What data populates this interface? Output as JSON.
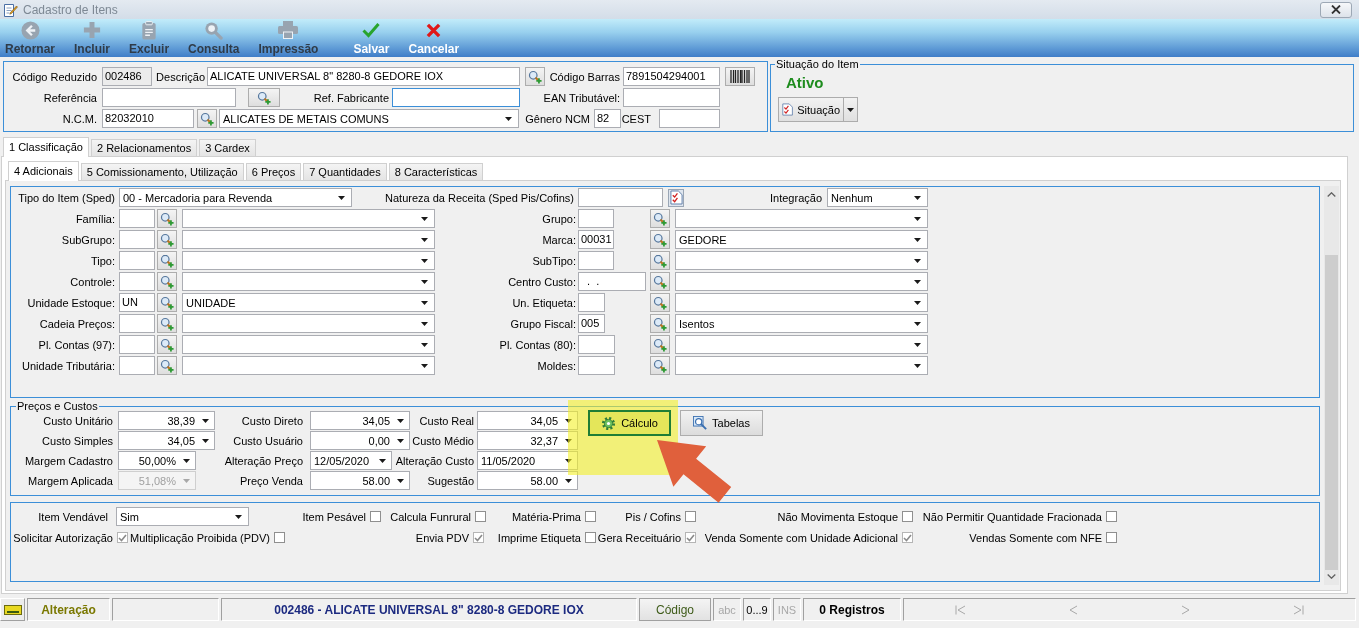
{
  "window": {
    "title": "Cadastro de Itens"
  },
  "toolbar": [
    {
      "kind": "back",
      "label": "Retornar",
      "disabled": true
    },
    {
      "kind": "add",
      "label": "Incluir",
      "disabled": true
    },
    {
      "kind": "delete",
      "label": "Excluir",
      "disabled": true
    },
    {
      "kind": "query",
      "label": "Consulta",
      "disabled": true
    },
    {
      "kind": "print",
      "label": "Impressão",
      "disabled": true
    },
    {
      "kind": "save",
      "label": "Salvar",
      "disabled": false
    },
    {
      "kind": "cancel",
      "label": "Cancelar",
      "disabled": false
    }
  ],
  "header": {
    "codigo_reduzido": {
      "label": "Código Reduzido",
      "value": "002486",
      "readonly": true
    },
    "descricao": {
      "label": "Descrição",
      "value": "ALICATE UNIVERSAL 8\" 8280-8 GEDORE IOX"
    },
    "codigo_barras": {
      "label": "Código Barras",
      "value": "7891504294001"
    },
    "referencia": {
      "label": "Referência"
    },
    "ref_fabricante": {
      "label": "Ref. Fabricante",
      "focused": true
    },
    "ean_tributavel": {
      "label": "EAN Tributável:"
    },
    "ncm": {
      "label": "N.C.M.",
      "value": "82032010",
      "description": "ALICATES DE METAIS COMUNS"
    },
    "genero_ncm": {
      "label": "Gênero NCM",
      "value": "82"
    },
    "cest": {
      "label": "CEST"
    }
  },
  "situacao": {
    "legend": "Situação do Item",
    "status": "Ativo",
    "button": "Situação"
  },
  "tabs": [
    {
      "label": "1 Classificação",
      "selected": true
    },
    {
      "label": "2 Relacionamentos",
      "selected": false
    },
    {
      "label": "3 Cardex",
      "selected": false
    }
  ],
  "subtabs": [
    {
      "label": "4 Adicionais",
      "selected": true
    },
    {
      "label": "5 Comissionamento, Utilização",
      "selected": false
    },
    {
      "label": "6 Preços",
      "selected": false
    },
    {
      "label": "7 Quantidades",
      "selected": false
    },
    {
      "label": "8 Características",
      "selected": false
    }
  ],
  "classificacao": {
    "tipo_item": {
      "label": "Tipo do Item (Sped)",
      "value": "00 - Mercadoria para Revenda"
    },
    "natureza_receita": {
      "label": "Natureza da Receita (Sped Pis/Cofins)"
    },
    "integracao": {
      "label": "Integração",
      "value": "Nenhum"
    },
    "left": [
      {
        "label": "Família:"
      },
      {
        "label": "SubGrupo:"
      },
      {
        "label": "Tipo:"
      },
      {
        "label": "Controle:"
      },
      {
        "label": "Unidade Estoque:",
        "code": "UN",
        "description": "UNIDADE"
      },
      {
        "label": "Cadeia Preços:"
      },
      {
        "label": "Pl. Contas (97):"
      },
      {
        "label": "Unidade Tributária:"
      }
    ],
    "right": [
      {
        "label": "Grupo:"
      },
      {
        "label": "Marca:",
        "code": "00031",
        "description": "GEDORE"
      },
      {
        "label": "SubTipo:"
      },
      {
        "label": "Centro Custo:",
        "code": "  .  ."
      },
      {
        "label": "Un. Etiqueta:"
      },
      {
        "label": "Grupo Fiscal:",
        "code": "005",
        "description": "Isentos"
      },
      {
        "label": "Pl. Contas (80):"
      },
      {
        "label": "Moldes:"
      }
    ]
  },
  "precos": {
    "legend": "Preços e Custos",
    "rows": [
      {
        "cells": [
          {
            "label": "Custo Unitário",
            "value": "38,39",
            "kind": "number",
            "disabled": false
          },
          {
            "label": "Custo Direto",
            "value": "34,05",
            "kind": "number",
            "disabled": false
          },
          {
            "label": "Custo Real",
            "value": "34,05",
            "kind": "number",
            "disabled": false
          }
        ]
      },
      {
        "cells": [
          {
            "label": "Custo Simples",
            "value": "34,05",
            "kind": "number",
            "disabled": false
          },
          {
            "label": "Custo Usuário",
            "value": "0,00",
            "kind": "number",
            "disabled": false
          },
          {
            "label": "Custo Médio",
            "value": "32,37",
            "kind": "number",
            "disabled": false
          }
        ]
      },
      {
        "cells": [
          {
            "label": "Margem Cadastro",
            "value": "50,00%",
            "kind": "percent",
            "disabled": false
          },
          {
            "label": "Alteração Preço",
            "value": "12/05/2020",
            "kind": "date",
            "disabled": false
          },
          {
            "label": "Alteração Custo",
            "value": "11/05/2020",
            "kind": "date",
            "disabled": false
          }
        ]
      },
      {
        "cells": [
          {
            "label": "Margem Aplicada",
            "value": "51,08%",
            "kind": "percent",
            "disabled": true
          },
          {
            "label": "Preço Venda",
            "value": "58.00",
            "kind": "number",
            "disabled": false
          },
          {
            "label": "Sugestão",
            "value": "58.00",
            "kind": "number",
            "disabled": false
          }
        ]
      }
    ],
    "buttons": [
      {
        "kind": "calc",
        "label": "Cálculo",
        "highlighted": true
      },
      {
        "kind": "tables",
        "label": "Tabelas",
        "highlighted": false
      }
    ]
  },
  "opcoes": {
    "rows": [
      {
        "items": [
          {
            "kind": "dropdown",
            "label": "Item Vendável",
            "value": "Sim"
          },
          {
            "kind": "checkbox",
            "label": "Item Pesável",
            "checked": false
          },
          {
            "kind": "checkbox",
            "label": "Calcula Funrural",
            "checked": false
          },
          {
            "kind": "checkbox",
            "label": "Matéria-Prima",
            "checked": false
          },
          {
            "kind": "checkbox",
            "label": "Pis / Cofins",
            "checked": false
          },
          {
            "kind": "checkbox",
            "label": "Não Movimenta Estoque",
            "checked": false
          },
          {
            "kind": "checkbox",
            "label": "Não Permitir Quantidade Fracionada",
            "checked": false
          }
        ]
      },
      {
        "items": [
          {
            "kind": "checkbox",
            "label": "Solicitar Autorização",
            "checked": true
          },
          {
            "kind": "checkbox",
            "label": "Multiplicação Proibida (PDV)",
            "checked": false
          },
          {
            "kind": "checkbox",
            "label": "Envia PDV",
            "checked": true
          },
          {
            "kind": "checkbox",
            "label": "Imprime Etiqueta",
            "checked": false
          },
          {
            "kind": "checkbox",
            "label": "Gera Receituário",
            "checked": true
          },
          {
            "kind": "checkbox",
            "label": "Venda Somente com Unidade Adicional",
            "checked": true
          },
          {
            "kind": "checkbox",
            "label": "Vendas Somente com NFE",
            "checked": false
          }
        ]
      }
    ]
  },
  "status_bar": {
    "mode": "Alteração",
    "record": "002486 - ALICATE UNIVERSAL 8\" 8280-8 GEDORE IOX",
    "code_button": "Código",
    "indicators": [
      {
        "label": "abc",
        "active": false
      },
      {
        "label": "0...9",
        "active": true
      },
      {
        "label": "INS",
        "active": false
      }
    ],
    "count": "0 Registros"
  }
}
